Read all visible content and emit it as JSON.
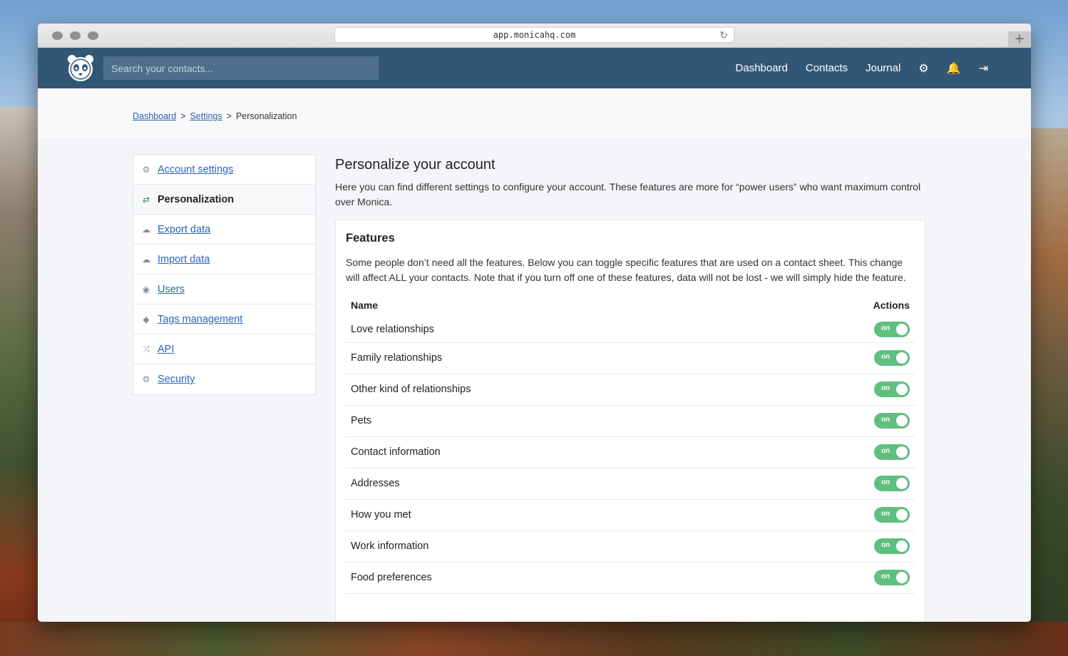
{
  "browser": {
    "url": "app.monicahq.com",
    "reload_icon": "↻",
    "newtab_icon": "+"
  },
  "topnav": {
    "search_placeholder": "Search your contacts...",
    "links": [
      "Dashboard",
      "Contacts",
      "Journal"
    ],
    "icons": {
      "settings": "⚙",
      "notifications": "🔔",
      "logout": "⇥"
    }
  },
  "breadcrumb": {
    "items": [
      "Dashboard",
      "Settings"
    ],
    "separator": ">",
    "current": "Personalization"
  },
  "sidebar": {
    "items": [
      {
        "label": "Account settings",
        "icon": "⚙",
        "icon_name": "gear-icon"
      },
      {
        "label": "Personalization",
        "icon": "⇄",
        "icon_name": "handshake-icon",
        "active": true
      },
      {
        "label": "Export data",
        "icon": "☁",
        "icon_name": "cloud-download-icon"
      },
      {
        "label": "Import data",
        "icon": "☁",
        "icon_name": "cloud-upload-icon"
      },
      {
        "label": "Users",
        "icon": "◉",
        "icon_name": "user-circle-icon"
      },
      {
        "label": "Tags management",
        "icon": "◆",
        "icon_name": "tags-icon"
      },
      {
        "label": "API",
        "icon": "⤨",
        "icon_name": "random-icon"
      },
      {
        "label": "Security",
        "icon": "⚙",
        "icon_name": "gear-icon"
      }
    ]
  },
  "main": {
    "title": "Personalize your account",
    "intro": "Here you can find different settings to configure your account. These features are more for “power users” who want maximum control over Monica.",
    "features": {
      "heading": "Features",
      "description": "Some people don’t need all the features. Below you can toggle specific features that are used on a contact sheet. This change will affect ALL your contacts. Note that if you turn off one of these features, data will not be lost - we will simply hide the feature.",
      "col_name": "Name",
      "col_actions": "Actions",
      "toggle_label": "on",
      "rows": [
        {
          "name": "Love relationships",
          "enabled": true
        },
        {
          "name": "Family relationships",
          "enabled": true
        },
        {
          "name": "Other kind of relationships",
          "enabled": true
        },
        {
          "name": "Pets",
          "enabled": true
        },
        {
          "name": "Contact information",
          "enabled": true
        },
        {
          "name": "Addresses",
          "enabled": true
        },
        {
          "name": "How you met",
          "enabled": true
        },
        {
          "name": "Work information",
          "enabled": true
        },
        {
          "name": "Food preferences",
          "enabled": true
        }
      ]
    }
  },
  "colors": {
    "nav_bg": "#325776",
    "link": "#2b63c4",
    "toggle_on": "#5fbf7f"
  }
}
